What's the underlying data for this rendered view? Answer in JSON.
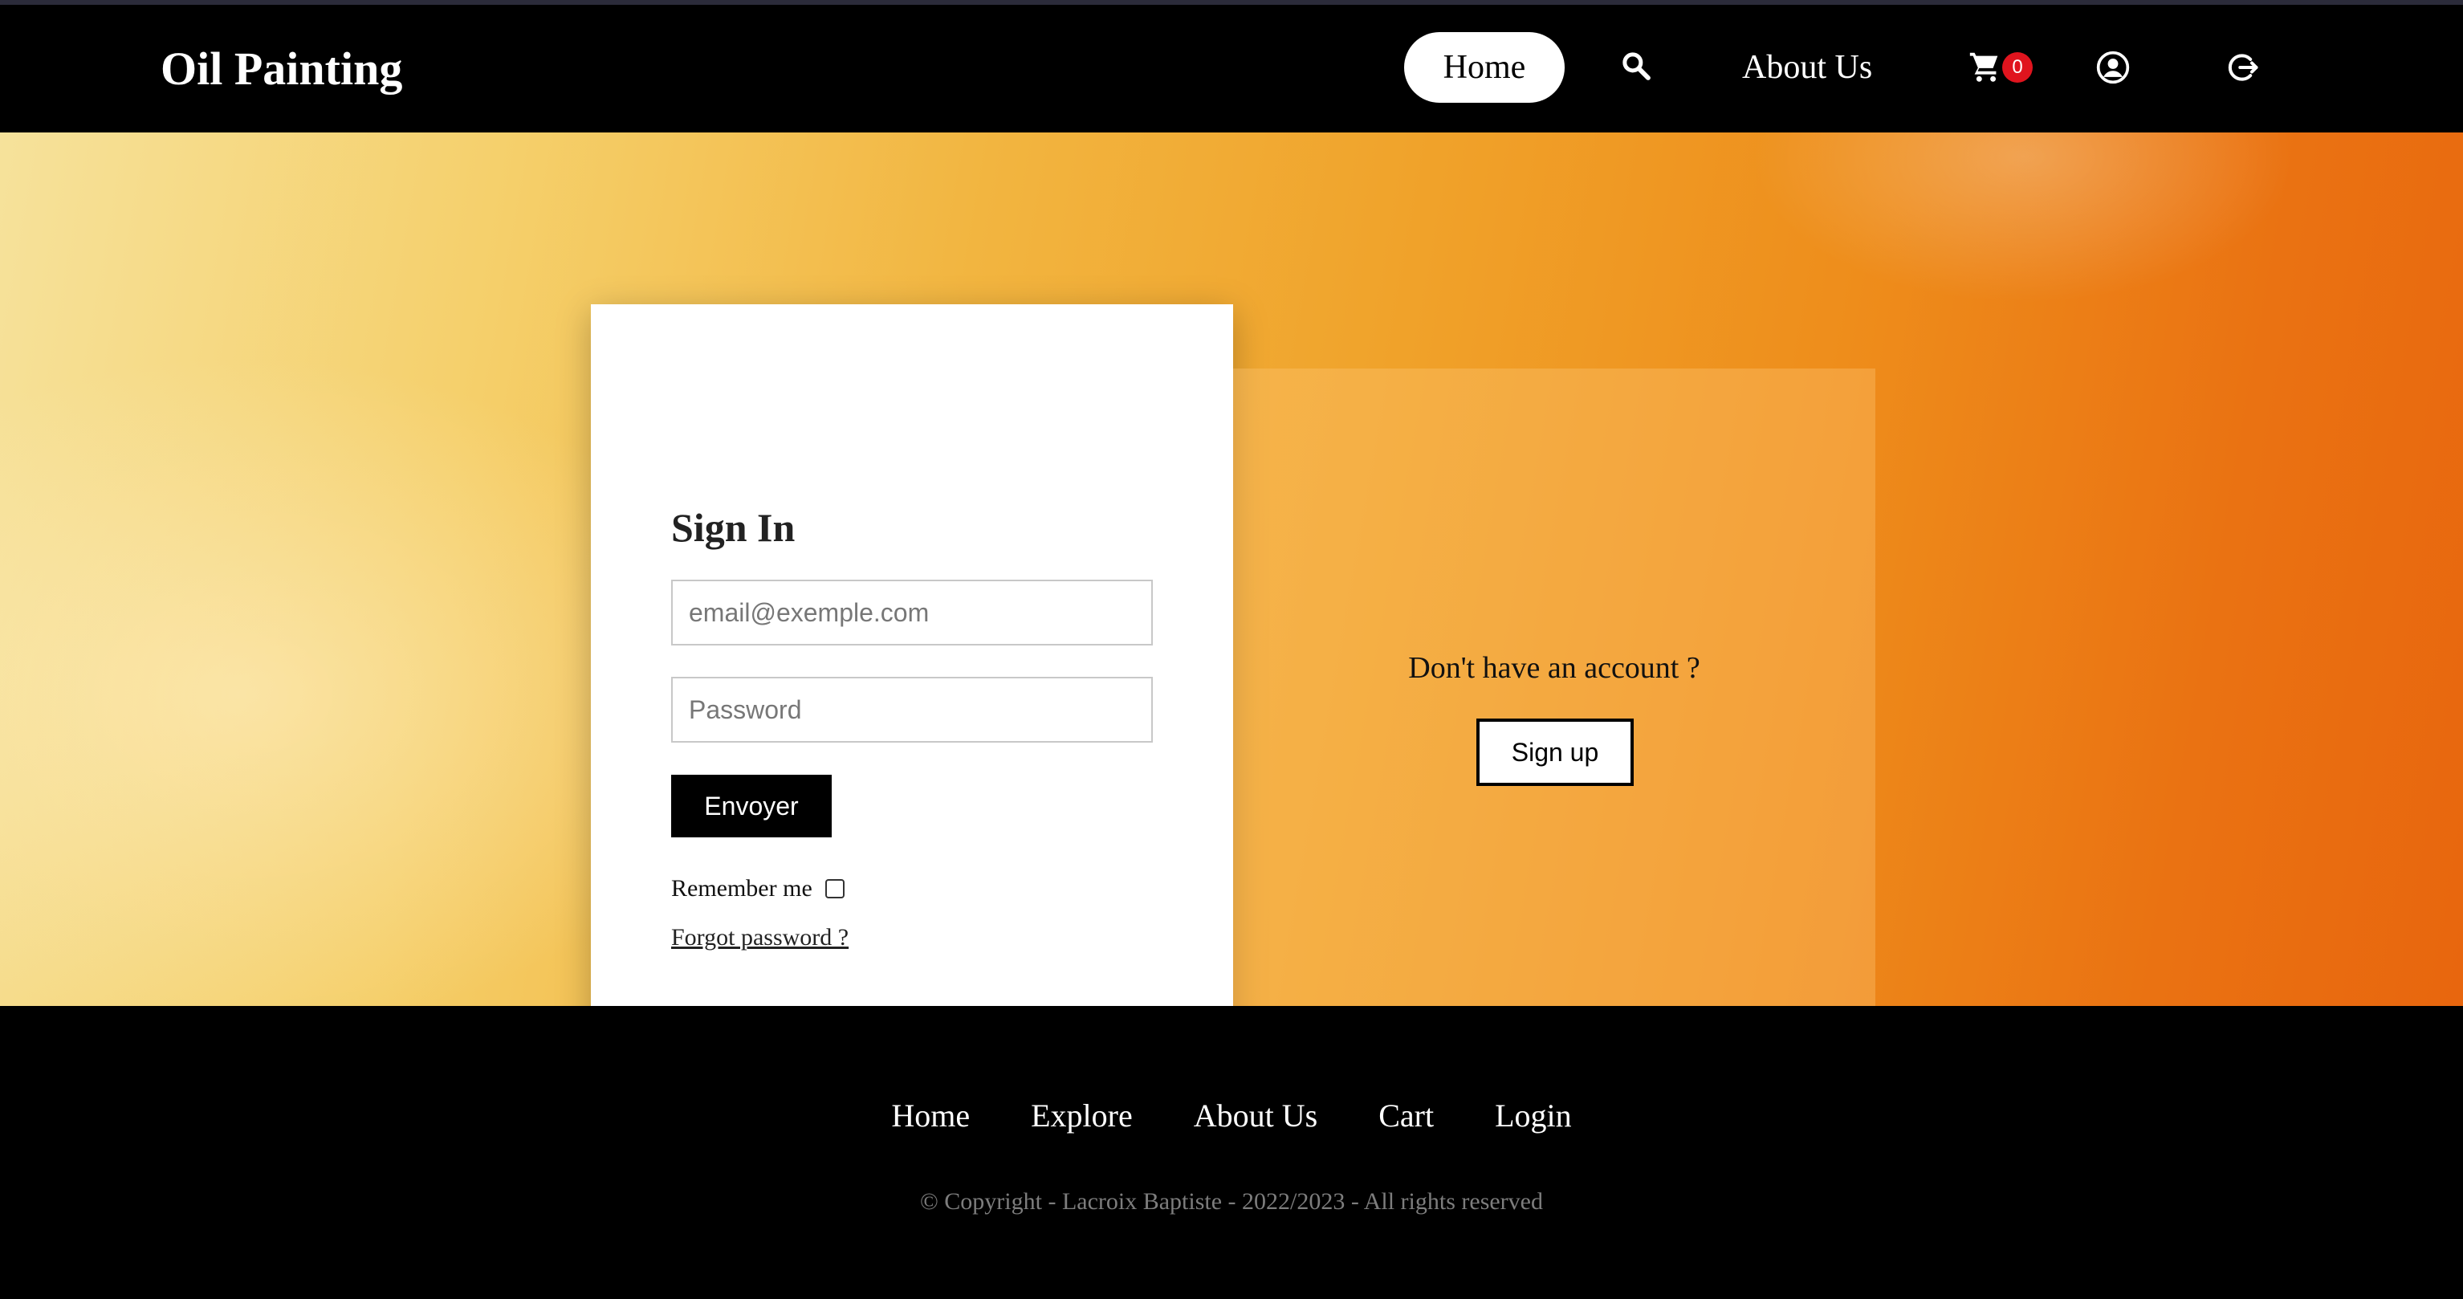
{
  "header": {
    "brand": "Oil Painting",
    "nav": {
      "home": "Home",
      "about": "About Us",
      "cart_count": "0"
    },
    "icons": [
      "search-icon",
      "cart-icon",
      "user-icon",
      "logout-icon"
    ]
  },
  "signin": {
    "title": "Sign In",
    "email_placeholder": "email@exemple.com",
    "password_placeholder": "Password",
    "submit_label": "Envoyer",
    "remember_label": "Remember me",
    "forgot_label": "Forgot password ?"
  },
  "signup": {
    "prompt": "Don't have an account ?",
    "button_label": "Sign up"
  },
  "footer": {
    "links": [
      "Home",
      "Explore",
      "About Us",
      "Cart",
      "Login"
    ],
    "copyright": "© Copyright - Lacroix Baptiste - 2022/2023 - All rights reserved"
  },
  "colors": {
    "nav_background": "#000000",
    "badge": "#e0141e",
    "hero_light": "#f6e29b",
    "hero_dark": "#e8660e"
  }
}
